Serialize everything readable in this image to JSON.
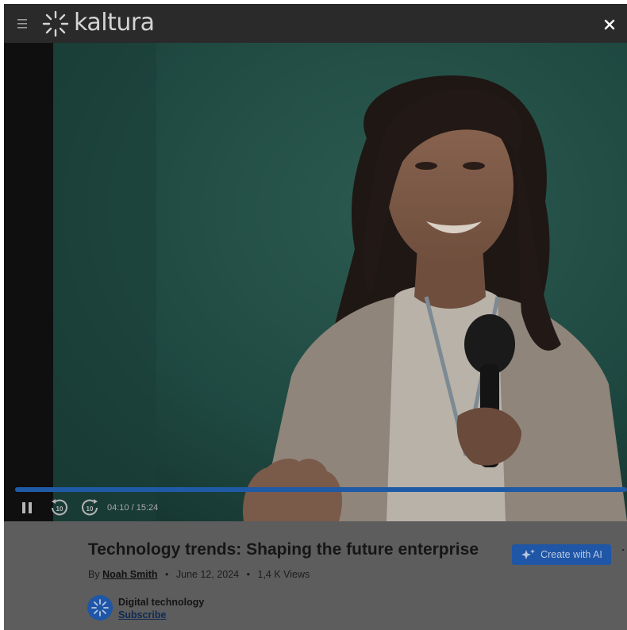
{
  "header": {
    "logo_text": "kaltura",
    "menu_icon": "hamburger-menu-icon",
    "close_icon": "close-icon"
  },
  "player": {
    "current_time": "04:10",
    "duration": "15:24",
    "time_display": "04:10 / 15:24",
    "progress_fraction": 1.0,
    "skip_back_label": "10",
    "skip_forward_label": "10",
    "accent_color": "#1f5aa6"
  },
  "video_info": {
    "title": "Technology trends: Shaping the future enterprise",
    "by_prefix": "By",
    "author": "Noah Smith",
    "date": "June 12, 2024",
    "views": "1,4 K Views",
    "separator": "•",
    "create_ai_label": "Create with AI",
    "more_label": "⋯"
  },
  "channel": {
    "name": "Digital technology",
    "subscribe_label": "Subscribe"
  }
}
